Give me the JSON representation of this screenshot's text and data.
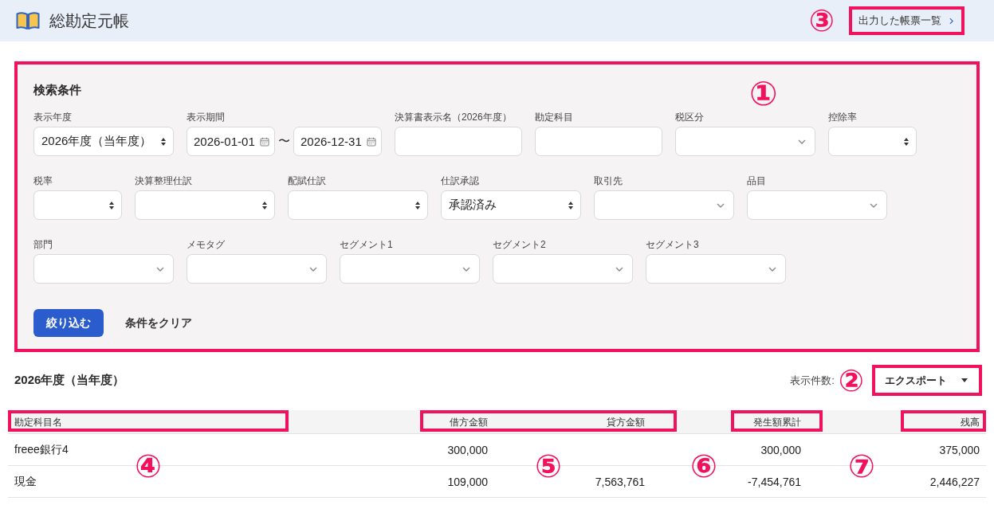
{
  "header": {
    "title": "総勘定元帳",
    "report_link": {
      "label": "出力した帳票一覧",
      "callout": "③"
    }
  },
  "search_panel": {
    "title": "検索条件",
    "callout": "①",
    "rows": [
      [
        {
          "label": "表示年度",
          "kind": "select",
          "value": "2026年度（当年度）"
        },
        {
          "label": "表示期間",
          "kind": "date_range",
          "start": "2026-01-01",
          "separator": "〜",
          "end": "2026-12-31"
        },
        {
          "label": "決算書表示名（2026年度）",
          "kind": "text"
        },
        {
          "label": "勘定科目",
          "kind": "text"
        },
        {
          "label": "税区分",
          "kind": "combobox"
        },
        {
          "label": "控除率",
          "kind": "select"
        }
      ],
      [
        {
          "label": "税率",
          "kind": "select"
        },
        {
          "label": "決算整理仕訳",
          "kind": "select"
        },
        {
          "label": "配賦仕訳",
          "kind": "select"
        },
        {
          "label": "仕訳承認",
          "kind": "select",
          "value": "承認済み"
        },
        {
          "label": "取引先",
          "kind": "combobox"
        },
        {
          "label": "品目",
          "kind": "combobox"
        }
      ],
      [
        {
          "label": "部門",
          "kind": "combobox"
        },
        {
          "label": "メモタグ",
          "kind": "combobox"
        },
        {
          "label": "セグメント1",
          "kind": "combobox"
        },
        {
          "label": "セグメント2",
          "kind": "combobox"
        },
        {
          "label": "セグメント3",
          "kind": "combobox"
        }
      ]
    ],
    "buttons": [
      {
        "label": "絞り込む",
        "kind": "primary"
      },
      {
        "label": "条件をクリア",
        "kind": "plain"
      }
    ]
  },
  "results": {
    "title": "2026年度（当年度）",
    "count_label": "表示件数:",
    "export_button": {
      "label": "エクスポート",
      "callout": "②"
    }
  },
  "table": {
    "column_groups": [
      {
        "callout": "④",
        "columns": [
          "勘定科目名"
        ]
      },
      {
        "callout": "⑤",
        "columns": [
          "借方金額",
          "貸方金額"
        ]
      },
      {
        "callout": "⑥",
        "columns": [
          "発生額累計"
        ]
      },
      {
        "callout": "⑦",
        "columns": [
          "残高"
        ]
      }
    ],
    "rows": [
      {
        "cells": [
          "freee銀行4",
          "300,000",
          null,
          "300,000",
          "375,000"
        ]
      },
      {
        "cells": [
          "現金",
          "109,000",
          "7,563,761",
          "-7,454,761",
          "2,446,227"
        ]
      }
    ]
  }
}
